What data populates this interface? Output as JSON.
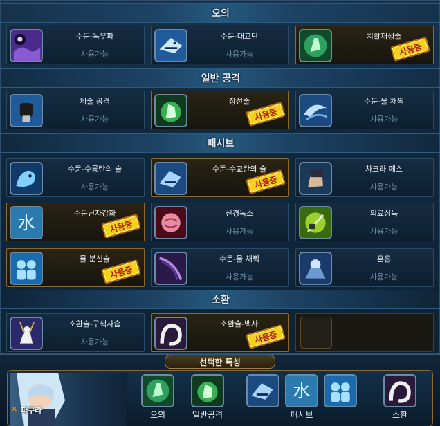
{
  "sections": [
    {
      "title": "오의"
    },
    {
      "title": "일반 공격"
    },
    {
      "title": "패시브"
    },
    {
      "title": "소환"
    }
  ],
  "skills": {
    "s1": {
      "name": "수둔-독무파",
      "status": "사용가능",
      "icon": "poison-mist-icon"
    },
    "s2": {
      "name": "수둔-대교탄",
      "status": "사용가능",
      "icon": "shark-icon"
    },
    "s3": {
      "name": "치활재생술",
      "status": "사용중",
      "icon": "healing-hand-icon"
    },
    "s4": {
      "name": "체술 공격",
      "status": "사용가능",
      "icon": "fist-icon"
    },
    "s5": {
      "name": "장선술",
      "status": "사용중",
      "icon": "green-palm-icon"
    },
    "s6": {
      "name": "수둔-물 채찍",
      "status": "사용가능",
      "icon": "water-whip-icon"
    },
    "s7": {
      "name": "수둔-수룡탄의 술",
      "status": "사용가능",
      "icon": "water-dragon-icon"
    },
    "s8": {
      "name": "수둔-수교탄의 술",
      "status": "사용중",
      "icon": "water-shark-icon"
    },
    "s9": {
      "name": "차크라 메스",
      "status": "사용가능",
      "icon": "chakra-glove-icon"
    },
    "s10": {
      "name": "수둔닌자강화",
      "status": "사용중",
      "icon": "water-kanji-icon"
    },
    "s11": {
      "name": "신경독소",
      "status": "사용가능",
      "icon": "brain-icon"
    },
    "s12": {
      "name": "의료심득",
      "status": "사용가능",
      "icon": "medical-needle-icon"
    },
    "s13": {
      "name": "물 분신술",
      "status": "사용중",
      "icon": "water-clone-icon"
    },
    "s14": {
      "name": "수둔-물 채찍",
      "status": "사용가능",
      "icon": "purple-whip-icon"
    },
    "s15": {
      "name": "혼흡",
      "status": "사용가능",
      "icon": "chakra-hands-icon"
    },
    "s16": {
      "name": "소환술-구색사슴",
      "status": "사용가능",
      "icon": "deer-icon"
    },
    "s17": {
      "name": "소환술-백사",
      "status": "사용중",
      "icon": "white-snake-icon"
    }
  },
  "bottom": {
    "title": "선택한 특성",
    "character_name": "파쿠라",
    "labels": {
      "ougi": "오의",
      "normal": "일반공격",
      "passive": "패시브",
      "summon": "소환"
    }
  },
  "colors": {
    "stamp_bg": "#f2d21b",
    "stamp_text": "#a8200f",
    "available_text": "#6f8fa6",
    "active_border": "#8a6a28"
  }
}
